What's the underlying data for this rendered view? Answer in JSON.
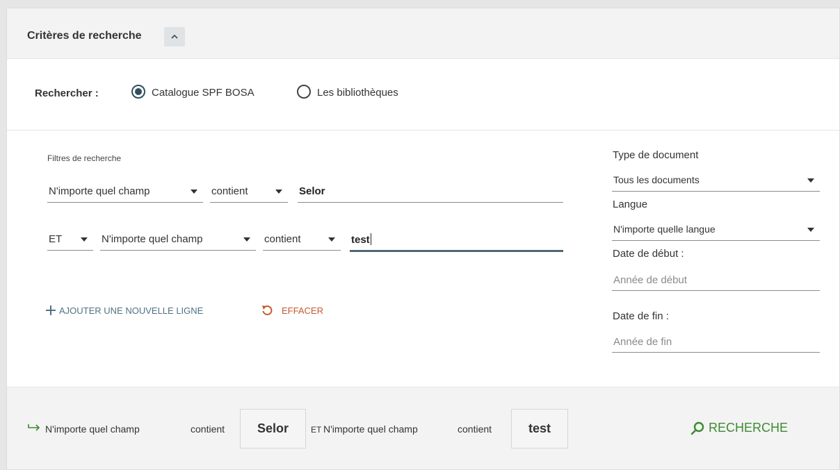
{
  "header": {
    "title": "Critères de recherche"
  },
  "scope": {
    "label": "Rechercher :",
    "options": [
      {
        "label": "Catalogue SPF BOSA",
        "selected": true
      },
      {
        "label": "Les bibliothèques",
        "selected": false
      }
    ]
  },
  "filters": {
    "title": "Filtres de recherche",
    "rows": [
      {
        "field": "N'importe quel champ",
        "operator": "contient",
        "value": "Selor"
      },
      {
        "boolean": "ET",
        "field": "N'importe quel champ",
        "operator": "contient",
        "value": "test"
      }
    ],
    "add_label": "AJOUTER UNE NOUVELLE LIGNE",
    "clear_label": "EFFACER"
  },
  "side": {
    "doc_type_label": "Type de document",
    "doc_type_value": "Tous les documents",
    "lang_label": "Langue",
    "lang_value": "N'importe quelle langue",
    "start_label": "Date de début :",
    "start_placeholder": "Année de début",
    "end_label": "Date de fin :",
    "end_placeholder": "Année de fin"
  },
  "summary": {
    "part1_field": "N'importe quel champ",
    "part1_op": "contient",
    "part1_value": "Selor",
    "joiner": "ET",
    "part2_field": "N'importe quel champ",
    "part2_op": "contient",
    "part2_value": "test",
    "search_label": "RECHERCHE"
  },
  "colors": {
    "accent_blue": "#4f7184",
    "clear_orange": "#c6582d",
    "search_green": "#3e8a32",
    "radio_selected": "#2f4f5f"
  },
  "icons": [
    "chevron-up-icon",
    "plus-icon",
    "undo-icon",
    "arrow-right-icon",
    "search-icon",
    "caret-down-icon"
  ]
}
